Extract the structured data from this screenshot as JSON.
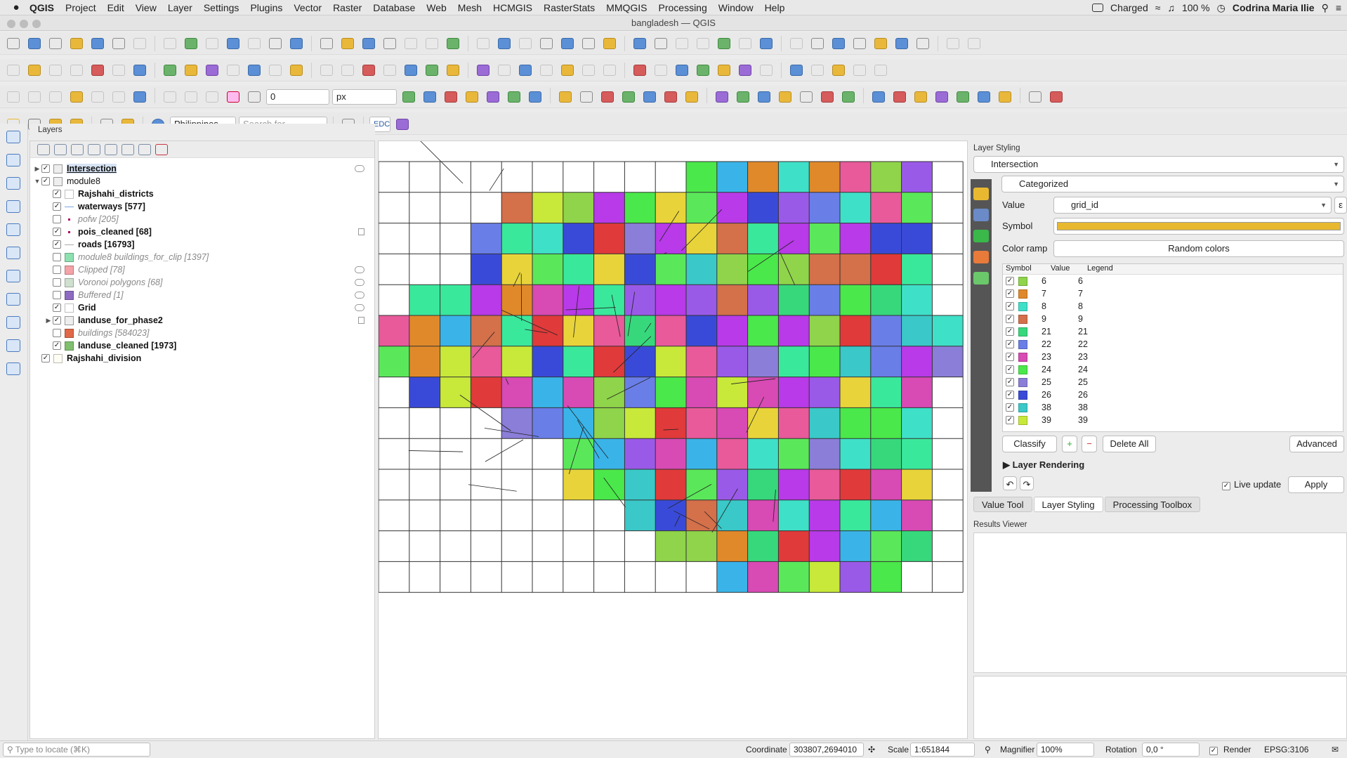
{
  "menubar": {
    "app_name": "QGIS",
    "items": [
      "Project",
      "Edit",
      "View",
      "Layer",
      "Settings",
      "Plugins",
      "Vector",
      "Raster",
      "Database",
      "Web",
      "Mesh",
      "HCMGIS",
      "RasterStats",
      "MMQGIS",
      "Processing",
      "Window",
      "Help"
    ],
    "battery_status": "Charged",
    "battery_percent": "100 %",
    "user": "Codrina Maria Ilie"
  },
  "window": {
    "title": "bangladesh — QGIS"
  },
  "toolbar3": {
    "offset_value": "0",
    "unit": "px"
  },
  "toolbar4": {
    "locator_country": "Philippines",
    "search_placeholder": "Search for...",
    "edc_label": "EDC"
  },
  "layers_panel": {
    "title": "Layers",
    "items": [
      {
        "label": "Intersection",
        "checked": true,
        "visible_style": "selected",
        "indent": 0,
        "arrow": "▶",
        "swatch": ""
      },
      {
        "label": "module8",
        "checked": true,
        "visible_style": "group",
        "indent": 0,
        "arrow": "▼",
        "swatch": ""
      },
      {
        "label": "Rajshahi_districts",
        "checked": true,
        "visible_style": "on",
        "indent": 1,
        "arrow": "",
        "swatch": "#ffffff"
      },
      {
        "label": "waterways [577]",
        "checked": true,
        "visible_style": "on",
        "indent": 1,
        "arrow": "",
        "swatch": "line-blue"
      },
      {
        "label": "pofw [205]",
        "checked": false,
        "visible_style": "off",
        "indent": 1,
        "arrow": "",
        "swatch": "dot"
      },
      {
        "label": "pois_cleaned [68]",
        "checked": true,
        "visible_style": "on",
        "indent": 1,
        "arrow": "",
        "swatch": "dot"
      },
      {
        "label": "roads [16793]",
        "checked": true,
        "visible_style": "on",
        "indent": 1,
        "arrow": "",
        "swatch": "line-grey"
      },
      {
        "label": "module8 buildings_for_clip [1397]",
        "checked": false,
        "visible_style": "off",
        "indent": 1,
        "arrow": "",
        "swatch": "#8ee0b0"
      },
      {
        "label": "Clipped [78]",
        "checked": false,
        "visible_style": "off",
        "indent": 1,
        "arrow": "",
        "swatch": "#f4a3a8"
      },
      {
        "label": "Voronoi polygons [68]",
        "checked": false,
        "visible_style": "off",
        "indent": 1,
        "arrow": "",
        "swatch": "#cfe0cf"
      },
      {
        "label": "Buffered [1]",
        "checked": false,
        "visible_style": "off",
        "indent": 1,
        "arrow": "",
        "swatch": "#8e6bc2"
      },
      {
        "label": "Grid",
        "checked": true,
        "visible_style": "on",
        "indent": 1,
        "arrow": "",
        "swatch": "#ffffff"
      },
      {
        "label": "landuse_for_phase2",
        "checked": true,
        "visible_style": "on",
        "indent": 1,
        "arrow": "▶",
        "swatch": ""
      },
      {
        "label": "buildings [584023]",
        "checked": false,
        "visible_style": "off",
        "indent": 1,
        "arrow": "",
        "swatch": "#e06848"
      },
      {
        "label": "landuse_cleaned [1973]",
        "checked": true,
        "visible_style": "on",
        "indent": 1,
        "arrow": "",
        "swatch": "#7fbf6f"
      },
      {
        "label": "Rajshahi_division",
        "checked": true,
        "visible_style": "on",
        "indent": 0,
        "arrow": "",
        "swatch": "#fdfdf3"
      }
    ]
  },
  "styling": {
    "title": "Layer Styling",
    "layer": "Intersection",
    "renderer": "Categorized",
    "value_label": "Value",
    "value_field": "grid_id",
    "symbol_label": "Symbol",
    "symbol_color": "#e8b930",
    "ramp_label": "Color ramp",
    "ramp_value": "Random colors",
    "table_headers": {
      "symbol": "Symbol",
      "value": "Value",
      "legend": "Legend"
    },
    "categories": [
      {
        "value": "6",
        "legend": "6",
        "color": "#8fd44a"
      },
      {
        "value": "7",
        "legend": "7",
        "color": "#e0892a"
      },
      {
        "value": "8",
        "legend": "8",
        "color": "#3fe0c8"
      },
      {
        "value": "9",
        "legend": "9",
        "color": "#d4704a"
      },
      {
        "value": "21",
        "legend": "21",
        "color": "#37d87c"
      },
      {
        "value": "22",
        "legend": "22",
        "color": "#6a7ee8"
      },
      {
        "value": "23",
        "legend": "23",
        "color": "#d84ab4"
      },
      {
        "value": "24",
        "legend": "24",
        "color": "#4ae84a"
      },
      {
        "value": "25",
        "legend": "25",
        "color": "#8a7ed8"
      },
      {
        "value": "26",
        "legend": "26",
        "color": "#3a4ad8"
      },
      {
        "value": "38",
        "legend": "38",
        "color": "#3ac8c8"
      },
      {
        "value": "39",
        "legend": "39",
        "color": "#c8e83a"
      }
    ],
    "classify": "Classify",
    "delete_all": "Delete All",
    "advanced": "Advanced",
    "layer_rendering": "Layer Rendering",
    "live_update": "Live update",
    "apply": "Apply"
  },
  "tabs": [
    "Value Tool",
    "Layer Styling",
    "Processing Toolbox"
  ],
  "active_tab": "Layer Styling",
  "results_viewer": {
    "title": "Results Viewer"
  },
  "statusbar": {
    "locate_placeholder": "Type to locate (⌘K)",
    "coordinate_label": "Coordinate",
    "coordinate_value": "303807,2694010",
    "scale_label": "Scale",
    "scale_value": "1:651844",
    "magnifier_label": "Magnifier",
    "magnifier_value": "100%",
    "rotation_label": "Rotation",
    "rotation_value": "0,0 °",
    "render_label": "Render",
    "crs": "EPSG:3106"
  }
}
